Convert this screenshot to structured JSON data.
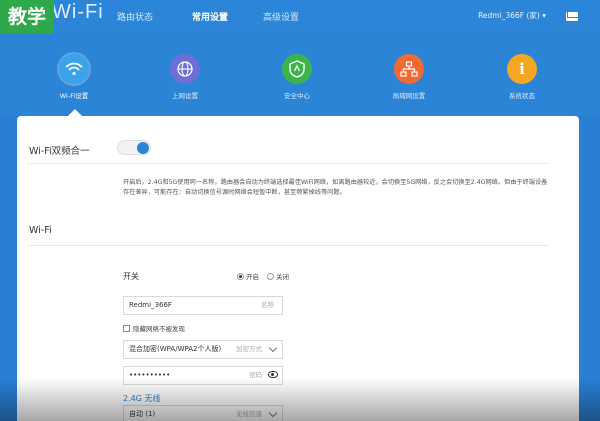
{
  "badge": "教学",
  "logo": "Wi-Fi",
  "nav": {
    "route_status": "路由状态",
    "common_settings": "常用设置",
    "advanced_settings": "高级设置"
  },
  "user": {
    "name": "Redmi_366F",
    "suffix": "(家)"
  },
  "icons": [
    {
      "name": "wifi-icon",
      "label": "Wi-Fi设置",
      "color": "#3aa3ea",
      "active": true
    },
    {
      "name": "globe-icon",
      "label": "上网设置",
      "color": "#6b6fd6"
    },
    {
      "name": "shield-icon",
      "label": "安全中心",
      "color": "#3bb54a"
    },
    {
      "name": "network-icon",
      "label": "局域网设置",
      "color": "#f06a32"
    },
    {
      "name": "info-icon",
      "label": "系统状态",
      "color": "#f5a623"
    }
  ],
  "dual_band": {
    "title": "Wi-Fi双频合一",
    "enabled": true,
    "description": "开启后，2.4G和5G使用同一名称，路由器会自动为终端选择最佳WiFi网络，如离路由器较近，会切换至5G网络，反之会切换至2.4G网络。但由于终端设备存在差异，可能存在：自动切换信号源时网络会短暂中断，甚至频繁掉线等问题。"
  },
  "wifi": {
    "title": "Wi-Fi",
    "switch_label": "开关",
    "on_label": "开启",
    "off_label": "关闭",
    "ssid": "Redmi_366F",
    "ssid_hint": "名称",
    "hide_network": "隐藏网络不被发现",
    "encryption": "混合加密(WPA/WPA2个人版)",
    "encryption_hint": "加密方式",
    "password": "••••••••••",
    "password_hint": "密码",
    "band_options_title": "2.4G 无线",
    "channel": "自动 (1)",
    "channel_hint": "无线信道"
  }
}
